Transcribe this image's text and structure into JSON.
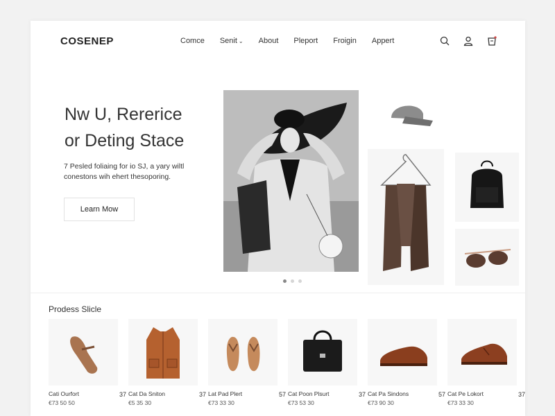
{
  "header": {
    "logo": "COSENEP",
    "nav": [
      {
        "label": "Comce"
      },
      {
        "label": "Senit",
        "has_dropdown": true
      },
      {
        "label": "About"
      },
      {
        "label": "Pleport"
      },
      {
        "label": "Froigin"
      },
      {
        "label": "Appert"
      }
    ],
    "icons": [
      "search-icon",
      "user-icon",
      "cart-icon"
    ]
  },
  "hero": {
    "title_line1": "Nw U, Rererice",
    "title_line2": "or Deting Stace",
    "subtitle_line1": "7 Pesled foliaing for io SJ, a yary wiltl",
    "subtitle_line2": "conestons wih ehert thesoporing.",
    "cta_label": "Learn Mow",
    "carousel": {
      "count": 3,
      "active": 1
    }
  },
  "products_section": {
    "title": "Prodess Slicle",
    "items": [
      {
        "name": "Cati Ourfort",
        "num": "37",
        "price": "€73 50 50",
        "icon": "sandals-icon"
      },
      {
        "name": "Cat Da Sniton",
        "num": "37",
        "price": "€5 35 30",
        "icon": "vest-icon"
      },
      {
        "name": "Lat Pad Plert",
        "num": "57",
        "price": "€73 33 30",
        "icon": "flip-flops-icon"
      },
      {
        "name": "Cat Poon Plsurt",
        "num": "37",
        "price": "€73 53 30",
        "icon": "handbag-icon"
      },
      {
        "name": "Cat Pa Sindons",
        "num": "57",
        "price": "€73 90 30",
        "icon": "loafer-icon"
      },
      {
        "name": "Cat Pe Lokort",
        "num": "37",
        "price": "€73 33 30",
        "icon": "oxford-shoe-icon"
      }
    ]
  },
  "colors": {
    "background": "#f2f2f2",
    "card": "#ffffff",
    "text": "#222222",
    "dot_active": "#888888"
  }
}
